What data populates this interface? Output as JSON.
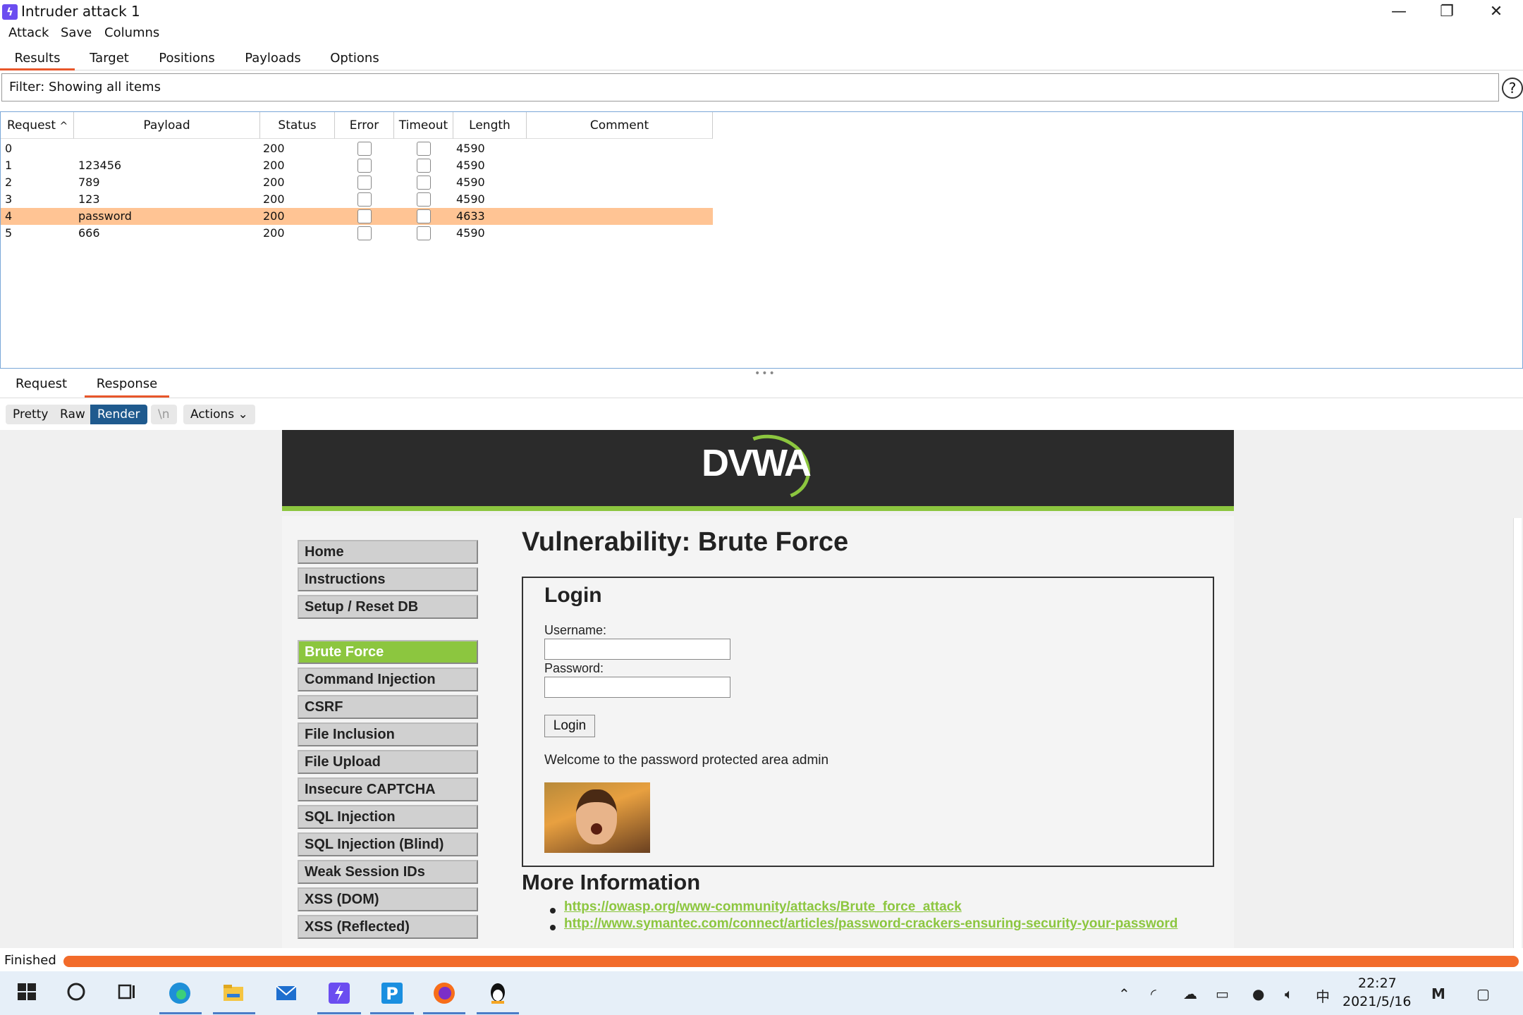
{
  "window": {
    "title": "Intruder attack 1",
    "minimize": "—",
    "restore": "❐",
    "close": "✕"
  },
  "menu": [
    "Attack",
    "Save",
    "Columns"
  ],
  "tabs": [
    "Results",
    "Target",
    "Positions",
    "Payloads",
    "Options"
  ],
  "filter": {
    "text": "Filter: Showing all items",
    "help": "?"
  },
  "table": {
    "headers": [
      "Request",
      "Payload",
      "Status",
      "Error",
      "Timeout",
      "Length",
      "Comment"
    ],
    "sort_indicator": "^",
    "rows": [
      {
        "request": "0",
        "payload": "",
        "status": "200",
        "length": "4590",
        "selected": false
      },
      {
        "request": "1",
        "payload": "123456",
        "status": "200",
        "length": "4590",
        "selected": false
      },
      {
        "request": "2",
        "payload": "789",
        "status": "200",
        "length": "4590",
        "selected": false
      },
      {
        "request": "3",
        "payload": "123",
        "status": "200",
        "length": "4590",
        "selected": false
      },
      {
        "request": "4",
        "payload": "password",
        "status": "200",
        "length": "4633",
        "selected": true
      },
      {
        "request": "5",
        "payload": "666",
        "status": "200",
        "length": "4590",
        "selected": false
      }
    ]
  },
  "splitter": "•••",
  "message_tabs": [
    "Request",
    "Response"
  ],
  "view_buttons": [
    "Pretty",
    "Raw",
    "Render",
    "\\n",
    "Actions ⌄"
  ],
  "dvwa": {
    "logo": "DVWA",
    "nav": [
      "Home",
      "Instructions",
      "Setup / Reset DB",
      "Brute Force",
      "Command Injection",
      "CSRF",
      "File Inclusion",
      "File Upload",
      "Insecure CAPTCHA",
      "SQL Injection",
      "SQL Injection (Blind)",
      "Weak Session IDs",
      "XSS (DOM)",
      "XSS (Reflected)"
    ],
    "page_title": "Vulnerability: Brute Force",
    "login_title": "Login",
    "username_label": "Username:",
    "password_label": "Password:",
    "login_button": "Login",
    "welcome": "Welcome to the password protected area admin",
    "more_info": "More Information",
    "links": [
      "https://owasp.org/www-community/attacks/Brute_force_attack",
      "http://www.symantec.com/connect/articles/password-crackers-ensuring-security-your-password"
    ]
  },
  "status": {
    "text": "Finished",
    "progress": 1.0
  },
  "taskbar": {
    "icons": [
      "windows-start-icon",
      "search-circle-icon",
      "task-view-icon",
      "edge-icon",
      "file-explorer-icon",
      "mail-icon",
      "burp-icon",
      "p-app-icon",
      "firefox-icon",
      "qq-icon"
    ],
    "tray_ime": "中",
    "time": "22:27",
    "date": "2021/5/16"
  },
  "accent_colors": {
    "orange": "#e8562a",
    "dvwa_green": "#8cc63f",
    "selected_row": "#ffc494"
  }
}
